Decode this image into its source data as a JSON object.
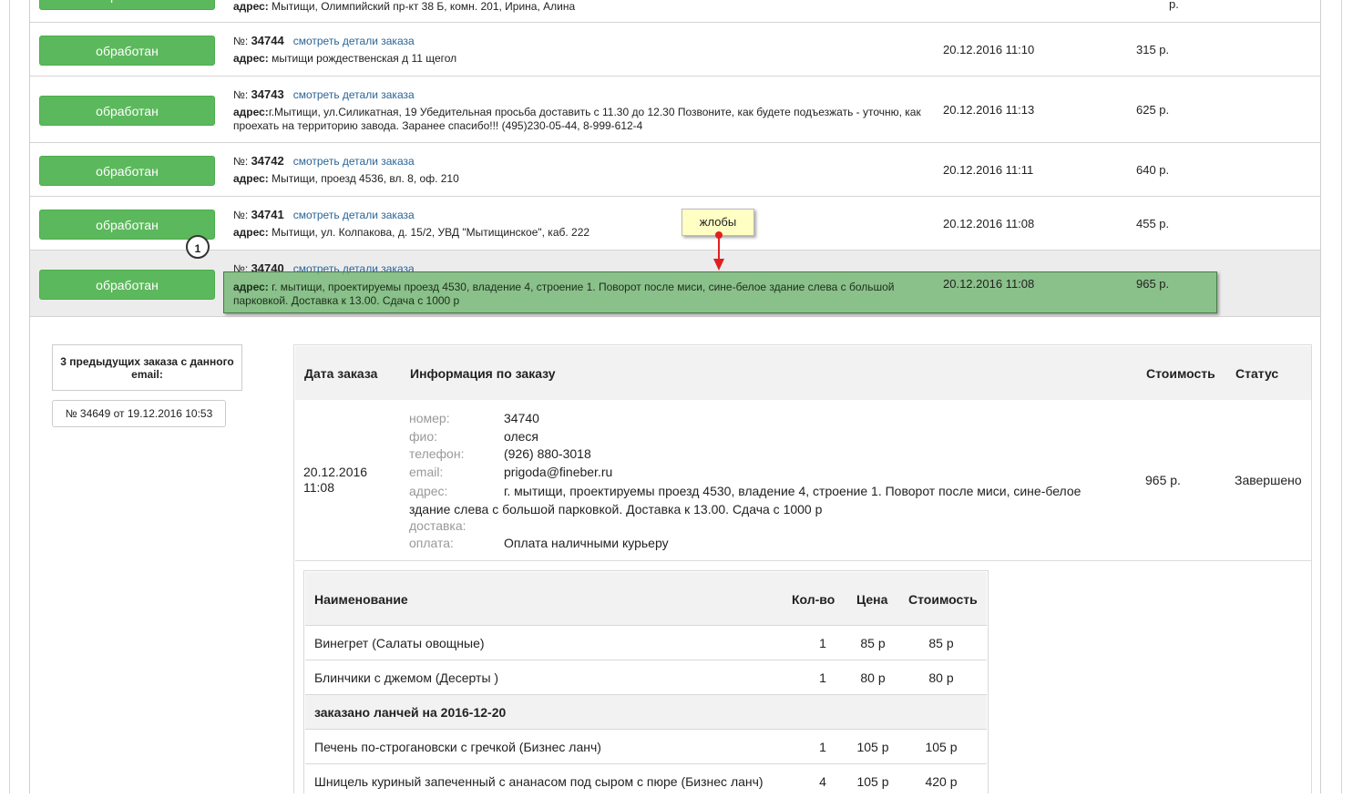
{
  "orders": [
    {
      "status_btn": "обработан",
      "address_label": "адрес:",
      "address": "Мытищи, Олимпийский пр-кт 38 Б, комн. 201, Ирина, Алина",
      "sum": "р."
    },
    {
      "status_btn": "обработан",
      "num_prefix": "№:",
      "number": "34744",
      "link": "смотреть детали заказа",
      "address_label": "адрес:",
      "address": "мытищи рождественская д 11 щегол",
      "date": "20.12.2016 11:10",
      "sum": "315 р."
    },
    {
      "status_btn": "обработан",
      "num_prefix": "№:",
      "number": "34743",
      "link": "смотреть детали заказа",
      "address_label": "адрес:",
      "address": "г.Мытищи, ул.Силикатная, 19 Убедительная просьба доставить с 11.30 до 12.30 Позвоните, как будете подъезжать - уточню, как проехать на территорию завода. Заранее спасибо!!! (495)230-05-44, 8-999-612-4",
      "date": "20.12.2016 11:13",
      "sum": "625 р."
    },
    {
      "status_btn": "обработан",
      "num_prefix": "№:",
      "number": "34742",
      "link": "смотреть детали заказа",
      "address_label": "адрес:",
      "address": "Мытищи, проезд 4536, вл. 8, оф. 210",
      "date": "20.12.2016 11:11",
      "sum": "640 р."
    },
    {
      "status_btn": "обработан",
      "num_prefix": "№:",
      "number": "34741",
      "link": "смотреть детали заказа",
      "address_label": "адрес:",
      "address": "Мытищи, ул. Колпакова, д. 15/2, УВД \"Мытищинское\", каб. 222",
      "date": "20.12.2016 11:08",
      "sum": "455 р."
    },
    {
      "status_btn": "обработан",
      "num_prefix": "№:",
      "number": "34740",
      "link": "смотреть детали заказа",
      "address_label": "адрес:",
      "address": "г. мытищи, проектируемы проезд 4530, владение 4, строение 1. Поворот после миси, сине-белое здание слева с большой парковкой. Доставка к 13.00. Сдача с 1000 р",
      "date": "20.12.2016 11:08",
      "sum": "965 р."
    }
  ],
  "annotation": {
    "callout_number": "1",
    "tooltip": "жлобы"
  },
  "previous_orders": {
    "title": "3 предыдущих заказа с данного email:",
    "items": [
      "№ 34649 от 19.12.2016 10:53"
    ]
  },
  "detail": {
    "headers": {
      "date": "Дата заказа",
      "info": "Информация по заказу",
      "cost": "Стоимость",
      "status": "Статус"
    },
    "date": "20.12.2016 11:08",
    "fields": {
      "number_label": "номер:",
      "number": "34740",
      "name_label": "фио:",
      "name": "олеся",
      "phone_label": "телефон:",
      "phone": "(926) 880-3018",
      "email_label": "email:",
      "email": "prigoda@fineber.ru",
      "address_label": "адрес:",
      "address": "г. мытищи, проектируемы проезд 4530, владение 4, строение 1. Поворот после миси, сине-белое здание слева с большой парковкой. Доставка к 13.00. Сдача с 1000 р",
      "delivery_label": "доставка:",
      "delivery": "",
      "payment_label": "оплата:",
      "payment": "Оплата наличными курьеру"
    },
    "cost": "965 р.",
    "status": "Завершено"
  },
  "items": {
    "headers": {
      "name": "Наименование",
      "qty": "Кол-во",
      "price": "Цена",
      "sum": "Стоимость"
    },
    "rows": [
      {
        "name": "Винегрет (Салаты овощные)",
        "qty": "1",
        "price": "85 р",
        "sum": "85 р"
      },
      {
        "name": "Блинчики с джемом (Десерты )",
        "qty": "1",
        "price": "80 р",
        "sum": "80 р"
      },
      {
        "group": "заказано ланчей на 2016-12-20"
      },
      {
        "name": "Печень по-строгановски с гречкой (Бизнес ланч)",
        "qty": "1",
        "price": "105 р",
        "sum": "105 р"
      },
      {
        "name": "Шницель куриный запеченный с ананасом под сыром с пюре (Бизнес ланч)",
        "qty": "4",
        "price": "105 р",
        "sum": "420 р"
      }
    ]
  },
  "colors": {
    "button_green": "#5cb85c",
    "link_blue": "#2a6496",
    "highlight_green": "#6eb46e",
    "arrow_red": "#e02020",
    "tooltip_yellow": "#ffffc4"
  }
}
